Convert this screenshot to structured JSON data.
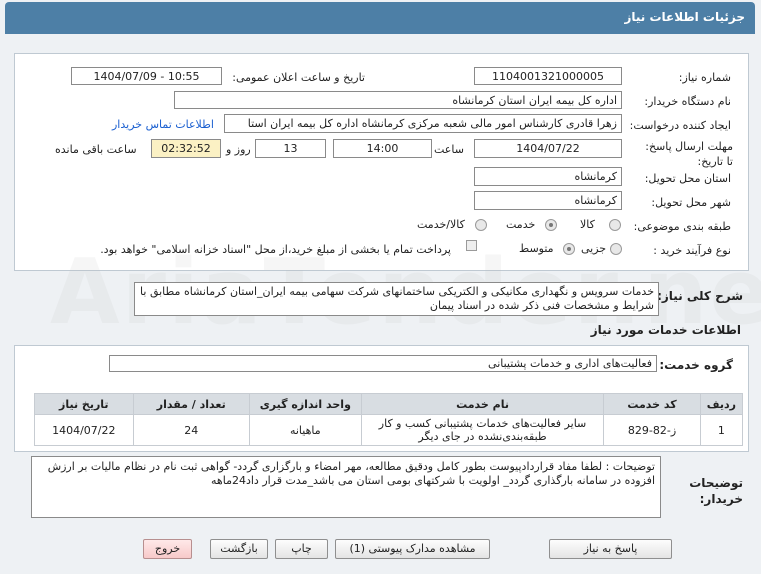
{
  "header": {
    "title": "جزئیات اطلاعات نیاز"
  },
  "form": {
    "need_number_label": "شماره نیاز:",
    "need_number": "1104001321000005",
    "announce_label": "تاریخ و ساعت اعلان عمومی:",
    "announce_value": "1404/07/09 - 10:55",
    "buyer_label": "نام دستگاه خریدار:",
    "buyer_value": "اداره کل بیمه ایران استان کرمانشاه",
    "creator_label": "ایجاد کننده درخواست:",
    "creator_value": "زهرا قادری کارشناس امور مالی شعبه مرکزی کرمانشاه اداره کل بیمه ایران استا",
    "contact_link": "اطلاعات تماس خریدار",
    "deadline_label": "مهلت ارسال پاسخ: تا تاریخ:",
    "deadline_date": "1404/07/22",
    "time_label": "ساعت",
    "deadline_time": "14:00",
    "days_value": "13",
    "days_label": "روز و",
    "remaining_time": "02:32:52",
    "remaining_label": "ساعت باقی مانده",
    "province_label": "استان محل تحویل:",
    "province_value": "کرمانشاه",
    "city_label": "شهر محل تحویل:",
    "city_value": "کرمانشاه",
    "category_label": "طبقه بندی موضوعی:",
    "category_options": [
      "کالا",
      "خدمت",
      "کالا/خدمت"
    ],
    "category_selected": "خدمت",
    "process_label": "نوع فرآیند خرید :",
    "process_options": [
      "جزیی",
      "متوسط"
    ],
    "process_selected": "متوسط",
    "payment_note": "پرداخت تمام یا بخشی از مبلغ خرید،از محل \"اسناد خزانه اسلامی\" خواهد بود."
  },
  "description": {
    "label": "شرح کلی نیاز:",
    "text": "خدمات سرویس و نگهداری مکانیکی و الکتریکی ساختمانهای شرکت سهامی بیمه ایران_استان کرمانشاه مطابق با شرایط و مشخصات فنی ذکر شده در اسناد پیمان"
  },
  "services": {
    "section_title": "اطلاعات خدمات مورد نیاز",
    "group_label": "گروه خدمت:",
    "group_value": "فعالیت‌های اداری و خدمات پشتیبانی",
    "columns": [
      "ردیف",
      "کد خدمت",
      "نام خدمت",
      "واحد اندازه گیری",
      "تعداد / مقدار",
      "تاریخ نیاز"
    ],
    "rows": [
      {
        "row": "1",
        "code": "ز-82-829",
        "name": "سایر فعالیت‌های خدمات پشتیبانی کسب و کار طبقه‌بندی‌نشده در جای دیگر",
        "unit": "ماهیانه",
        "qty": "24",
        "date": "1404/07/22"
      }
    ]
  },
  "notes": {
    "label": "توضیحات خریدار:",
    "text": "توضیحات :  لطفا مفاد قراردادپیوست بطور کامل ودقیق مطالعه، مهر امضاء و بارگزاری گردد- گواهی ثبت نام در نظام مالیات بر ارزش افزوده در سامانه بارگذاری گردد_ اولویت با شرکتهای بومی استان می باشد_مدت قرار داد24ماهه"
  },
  "buttons": {
    "reply": "پاسخ به نیاز",
    "attachments": "مشاهده مدارک پیوستی (1)",
    "print": "چاپ",
    "back": "بازگشت",
    "exit": "خروج"
  },
  "colors": {
    "header_bg": "#4d7fa6",
    "link": "#1a5fd0",
    "remaining_bg": "#fbf1c4",
    "exit_bg": "#f7c9c9"
  }
}
